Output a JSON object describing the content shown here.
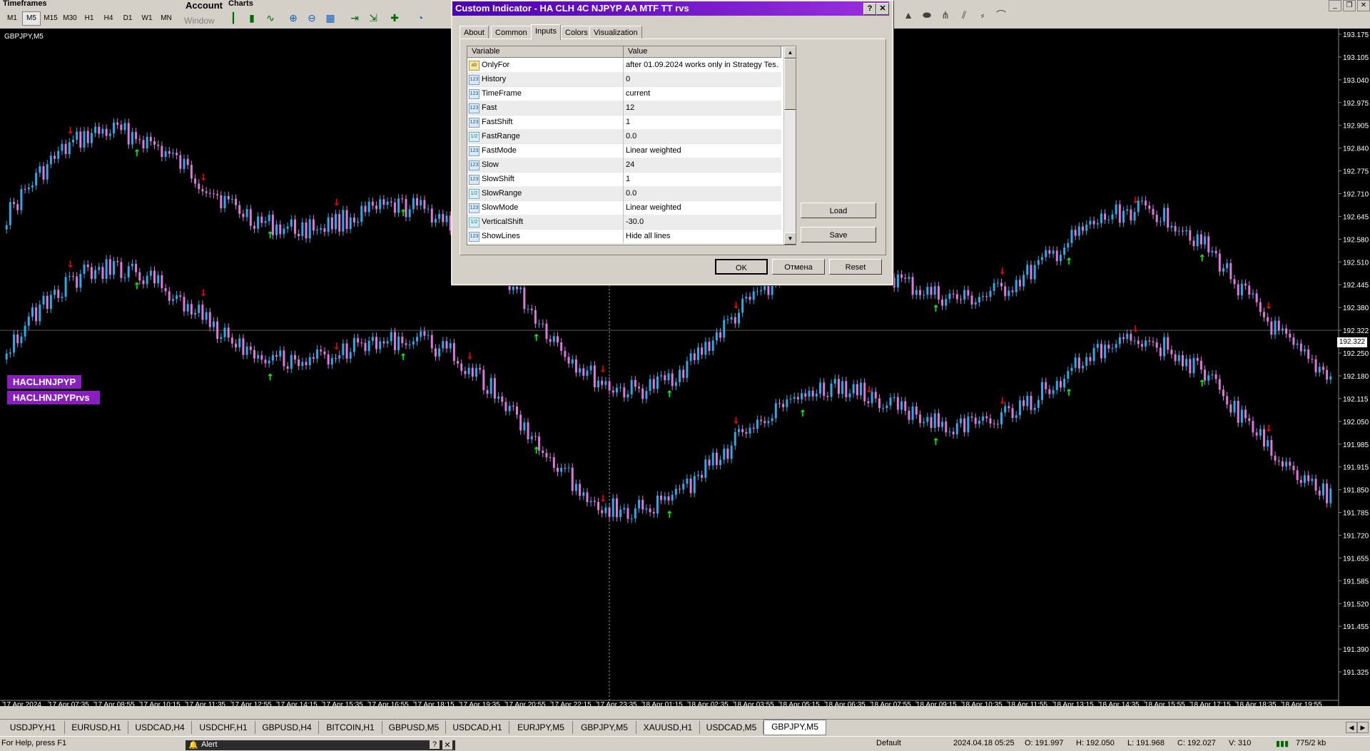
{
  "toolbar": {
    "timeframes_title": "Timeframes",
    "account_title": "Account",
    "account_window": "Window",
    "charts_title": "Charts",
    "timeframes": [
      "M1",
      "M5",
      "M15",
      "M30",
      "H1",
      "H4",
      "D1",
      "W1",
      "MN"
    ],
    "active_timeframe": "M5"
  },
  "chart": {
    "symbol_label": "GBPJPY,M5",
    "indicator_labels": [
      "HACLHNJPYP",
      "HACLHNJPYPrvs"
    ],
    "current_price": "192.322",
    "price_ticks": [
      "193.175",
      "193.105",
      "193.040",
      "192.975",
      "192.905",
      "192.840",
      "192.775",
      "192.710",
      "192.645",
      "192.580",
      "192.510",
      "192.445",
      "192.380",
      "192.322",
      "192.250",
      "192.180",
      "192.115",
      "192.050",
      "191.985",
      "191.915",
      "191.850",
      "191.785",
      "191.720",
      "191.655",
      "191.585",
      "191.520",
      "191.455",
      "191.390",
      "191.325"
    ],
    "time_ticks": [
      "17 Apr 2024",
      "17 Apr 07:35",
      "17 Apr 08:55",
      "17 Apr 10:15",
      "17 Apr 11:35",
      "17 Apr 12:55",
      "17 Apr 14:15",
      "17 Apr 15:35",
      "17 Apr 16:55",
      "17 Apr 18:15",
      "17 Apr 19:35",
      "17 Apr 20:55",
      "17 Apr 22:15",
      "17 Apr 23:35",
      "18 Apr 01:15",
      "18 Apr 02:35",
      "18 Apr 03:55",
      "18 Apr 05:15",
      "18 Apr 06:35",
      "18 Apr 07:55",
      "18 Apr 09:15",
      "18 Apr 10:35",
      "18 Apr 11:55",
      "18 Apr 13:15",
      "18 Apr 14:35",
      "18 Apr 15:55",
      "18 Apr 17:15",
      "18 Apr 18:35",
      "18 Apr 19:55"
    ],
    "colors": {
      "up": "#2fa8e8",
      "down": "#d97ad9",
      "up_arrow": "#00ff00",
      "down_arrow": "#ff0000",
      "background": "#000000"
    }
  },
  "dialog": {
    "title": "Custom Indicator - HA CLH 4C NJPYP AA MTF TT rvs",
    "help_btn": "?",
    "close_btn": "✕",
    "tabs": [
      "About",
      "Common",
      "Inputs",
      "Colors",
      "Visualization"
    ],
    "active_tab": "Inputs",
    "col_variable": "Variable",
    "col_value": "Value",
    "rows": [
      {
        "type": "ab",
        "name": "OnlyFor",
        "value": "after 01.09.2024 works only in Strategy Tes..."
      },
      {
        "type": "123",
        "name": "History",
        "value": "0"
      },
      {
        "type": "123",
        "name": "TimeFrame",
        "value": "current"
      },
      {
        "type": "123",
        "name": "Fast",
        "value": "12"
      },
      {
        "type": "123",
        "name": "FastShift",
        "value": "1"
      },
      {
        "type": "1/2",
        "name": "FastRange",
        "value": "0.0"
      },
      {
        "type": "123",
        "name": "FastMode",
        "value": "Linear weighted"
      },
      {
        "type": "123",
        "name": "Slow",
        "value": "24"
      },
      {
        "type": "123",
        "name": "SlowShift",
        "value": "1"
      },
      {
        "type": "1/2",
        "name": "SlowRange",
        "value": "0.0"
      },
      {
        "type": "123",
        "name": "SlowMode",
        "value": "Linear weighted"
      },
      {
        "type": "1/2",
        "name": "VerticalShift",
        "value": "-30.0"
      },
      {
        "type": "123",
        "name": "ShowLines",
        "value": "Hide all lines"
      }
    ],
    "load_label": "Load",
    "save_label": "Save",
    "ok_label": "OK",
    "cancel_label": "Отмена",
    "reset_label": "Reset"
  },
  "symbol_tabs": [
    "USDJPY,H1",
    "EURUSD,H1",
    "USDCAD,H4",
    "USDCHF,H1",
    "GBPUSD,H4",
    "BITCOIN,H1",
    "GBPUSD,M5",
    "USDCAD,H1",
    "EURJPY,M5",
    "GBPJPY,M5",
    "XAUUSD,H1",
    "USDCAD,M5",
    "GBPJPY,M5"
  ],
  "active_symbol_tab": 12,
  "status": {
    "help": "For Help, press F1",
    "alert_title": "Alert",
    "profile": "Default",
    "datetime": "2024.04.18 05:25",
    "open": "O: 191.997",
    "high": "H: 192.050",
    "low": "L: 191.968",
    "close": "C: 192.027",
    "volume": "V: 310",
    "traffic": "775/2 kb"
  }
}
